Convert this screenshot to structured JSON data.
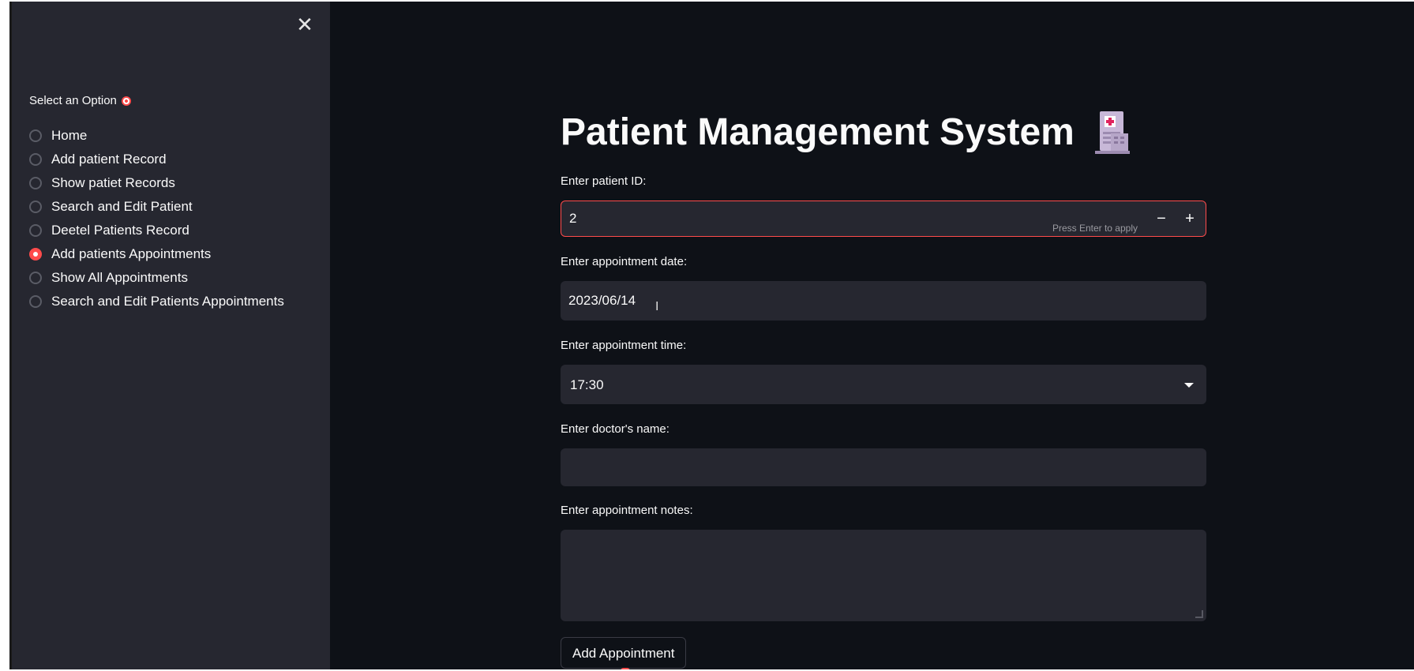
{
  "sidebar": {
    "close_icon": "close-icon",
    "label": "Select an Option",
    "label_icon": "target-icon",
    "options": [
      {
        "label": "Home",
        "selected": false
      },
      {
        "label": "Add patient Record",
        "selected": false
      },
      {
        "label": "Show patiet Records",
        "selected": false
      },
      {
        "label": "Search and Edit Patient",
        "selected": false
      },
      {
        "label": "Deetel Patients Record",
        "selected": false
      },
      {
        "label": "Add patients Appointments",
        "selected": true
      },
      {
        "label": "Show All Appointments",
        "selected": false
      },
      {
        "label": "Search and Edit Patients Appointments",
        "selected": false
      }
    ]
  },
  "main": {
    "title": "Patient Management System",
    "title_icon": "hospital-icon",
    "patient_id": {
      "label": "Enter patient ID:",
      "value": "2",
      "hint": "Press Enter to apply",
      "minus": "−",
      "plus": "+"
    },
    "date": {
      "label": "Enter appointment date:",
      "value": "2023/06/14"
    },
    "time": {
      "label": "Enter appointment time:",
      "value": "17:30"
    },
    "doctor": {
      "label": "Enter doctor's name:",
      "value": ""
    },
    "notes": {
      "label": "Enter appointment notes:",
      "value": ""
    },
    "submit_label": "Add Appointment"
  },
  "colors": {
    "accent": "#ff4b4b",
    "background": "#0e1117",
    "sidebar": "#262730",
    "input": "#262730",
    "text": "#fafafa"
  }
}
